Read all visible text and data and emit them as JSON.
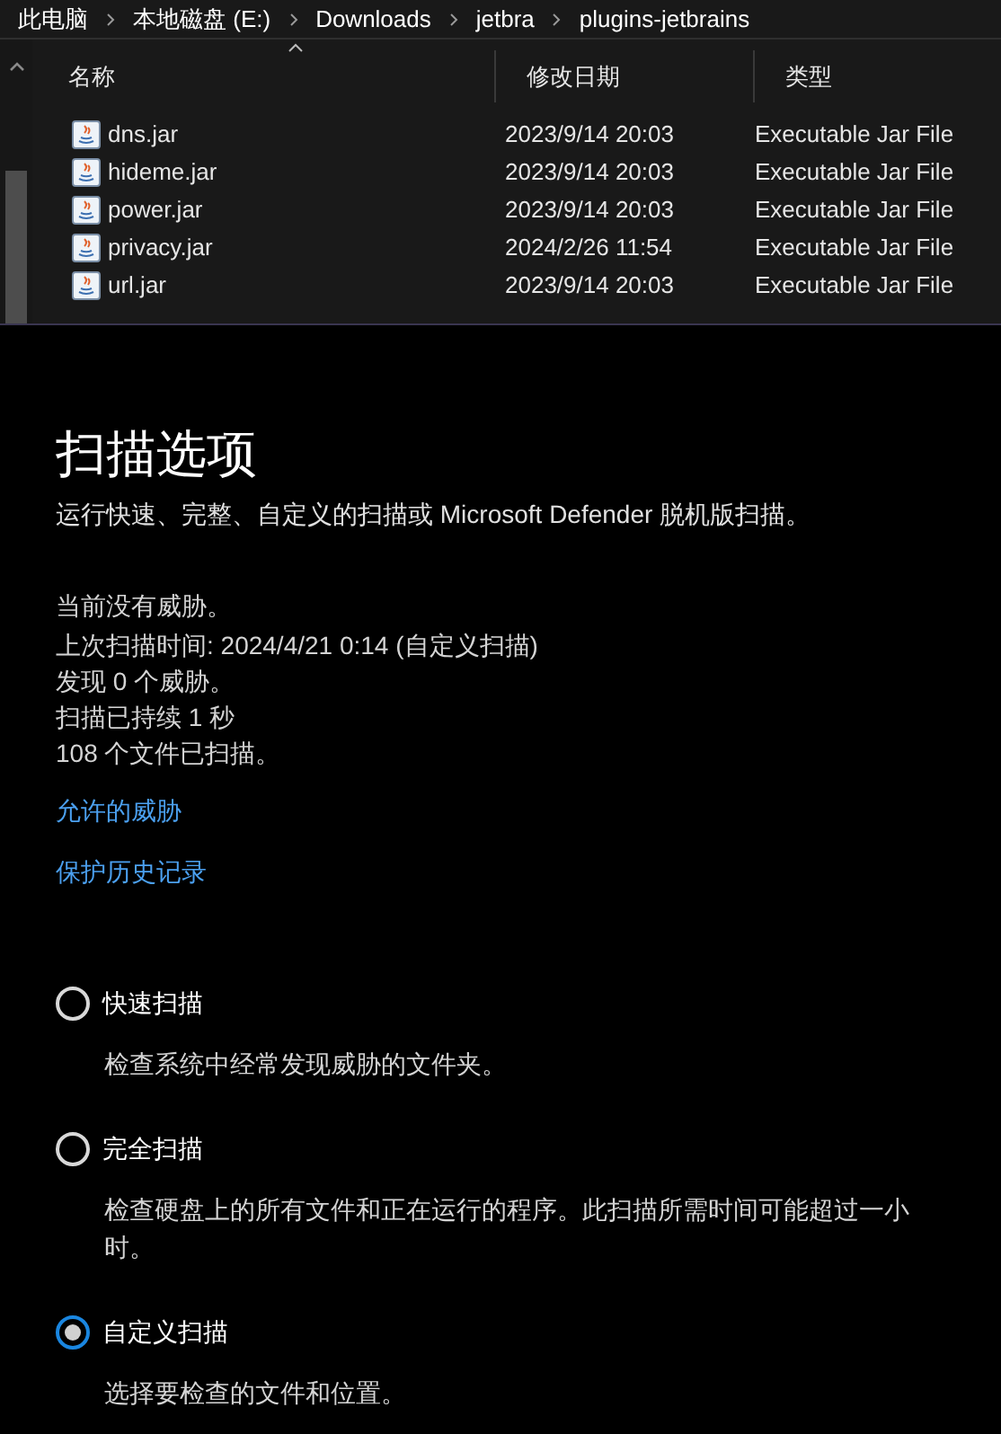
{
  "breadcrumb": [
    "此电脑",
    "本地磁盘 (E:)",
    "Downloads",
    "jetbra",
    "plugins-jetbrains"
  ],
  "file_list": {
    "columns": [
      "名称",
      "修改日期",
      "类型"
    ],
    "rows": [
      {
        "name": "dns.jar",
        "modified": "2023/9/14 20:03",
        "type": "Executable Jar File"
      },
      {
        "name": "hideme.jar",
        "modified": "2023/9/14 20:03",
        "type": "Executable Jar File"
      },
      {
        "name": "power.jar",
        "modified": "2023/9/14 20:03",
        "type": "Executable Jar File"
      },
      {
        "name": "privacy.jar",
        "modified": "2024/2/26 11:54",
        "type": "Executable Jar File"
      },
      {
        "name": "url.jar",
        "modified": "2023/9/14 20:03",
        "type": "Executable Jar File"
      }
    ]
  },
  "scan_options": {
    "title": "扫描选项",
    "subtitle": "运行快速、完整、自定义的扫描或 Microsoft Defender 脱机版扫描。",
    "status_lines": [
      "当前没有威胁。",
      "上次扫描时间: 2024/4/21 0:14 (自定义扫描)",
      "发现 0 个威胁。",
      "扫描已持续 1 秒",
      "108 个文件已扫描。"
    ],
    "links": [
      "允许的威胁",
      "保护历史记录"
    ],
    "options": [
      {
        "label": "快速扫描",
        "description": "检查系统中经常发现威胁的文件夹。",
        "selected": false
      },
      {
        "label": "完全扫描",
        "description": "检查硬盘上的所有文件和正在运行的程序。此扫描所需时间可能超过一小时。",
        "selected": false
      },
      {
        "label": "自定义扫描",
        "description": "选择要检查的文件和位置。",
        "selected": true
      }
    ]
  }
}
